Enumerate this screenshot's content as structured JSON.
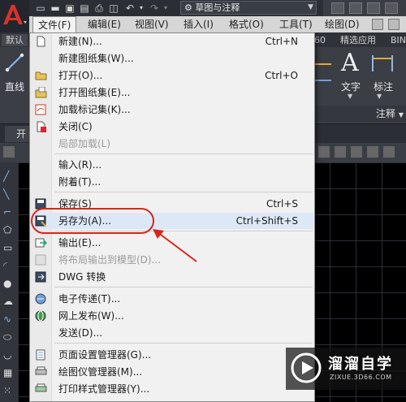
{
  "workspace": "草图与注释",
  "menubar": [
    "文件(F)",
    "编辑(E)",
    "视图(V)",
    "插入(I)",
    "格式(O)",
    "工具(T)",
    "绘图(D)"
  ],
  "ribbon_tabs": [
    "默认",
    "60",
    "精选应用",
    "BIN"
  ],
  "ribbon": {
    "line_label": "直线",
    "text_label": "文字",
    "dim_label": "标注",
    "annotation_panel": "注释"
  },
  "doc_tab": "开",
  "file_menu": [
    {
      "label": "新建(N)...",
      "shortcut": "Ctrl+N",
      "icon": "new-file-icon"
    },
    {
      "label": "新建图纸集(W)...",
      "shortcut": "",
      "icon": ""
    },
    {
      "label": "打开(O)...",
      "shortcut": "Ctrl+O",
      "icon": "open-folder-icon"
    },
    {
      "label": "打开图纸集(E)...",
      "shortcut": "",
      "icon": "open-sheetset-icon"
    },
    {
      "label": "加载标记集(K)...",
      "shortcut": "",
      "icon": "markup-icon"
    },
    {
      "label": "关闭(C)",
      "shortcut": "",
      "icon": "close-file-icon"
    },
    {
      "label": "局部加载(L)",
      "shortcut": "",
      "icon": "",
      "disabled": true
    },
    {
      "label": "输入(R)...",
      "shortcut": "",
      "icon": ""
    },
    {
      "label": "附着(T)...",
      "shortcut": "",
      "icon": ""
    },
    {
      "label": "保存(S)",
      "shortcut": "Ctrl+S",
      "icon": "save-icon"
    },
    {
      "label": "另存为(A)...",
      "shortcut": "Ctrl+Shift+S",
      "icon": "save-as-icon"
    },
    {
      "label": "输出(E)...",
      "shortcut": "",
      "icon": "export-icon"
    },
    {
      "label": "将布局输出到模型(D)...",
      "shortcut": "",
      "icon": "layout-export-icon",
      "disabled": true
    },
    {
      "label": "DWG 转换",
      "shortcut": "",
      "icon": "dwg-convert-icon"
    },
    {
      "label": "电子传递(T)...",
      "shortcut": "",
      "icon": "etransmit-icon"
    },
    {
      "label": "网上发布(W)...",
      "shortcut": "",
      "icon": "publish-web-icon"
    },
    {
      "label": "发送(D)...",
      "shortcut": "",
      "icon": ""
    },
    {
      "label": "页面设置管理器(G)...",
      "shortcut": "",
      "icon": "page-setup-icon"
    },
    {
      "label": "绘图仪管理器(M)...",
      "shortcut": "",
      "icon": "plotter-icon"
    },
    {
      "label": "打印样式管理器(Y)...",
      "shortcut": "",
      "icon": "plot-style-icon"
    }
  ],
  "watermark": {
    "title": "溜溜自学",
    "url": "ZIXUE.3D66.COM"
  },
  "colors": {
    "accent_red": "#d9251d",
    "menu_bg": "#f1f1f1",
    "dark_ui": "#3b3e45"
  }
}
